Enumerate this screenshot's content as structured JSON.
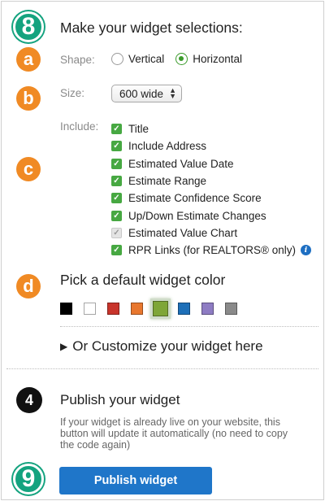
{
  "badges": {
    "step8": "8",
    "a": "a",
    "b": "b",
    "c": "c",
    "d": "d",
    "step4": "4",
    "step9": "9"
  },
  "selections": {
    "heading": "Make your widget selections:",
    "shape": {
      "label": "Shape:",
      "options": [
        {
          "label": "Vertical",
          "selected": false
        },
        {
          "label": "Horizontal",
          "selected": true
        }
      ]
    },
    "size": {
      "label": "Size:",
      "value": "600 wide"
    },
    "include": {
      "label": "Include:",
      "items": [
        {
          "label": "Title",
          "checked": true,
          "disabled": false
        },
        {
          "label": "Include Address",
          "checked": true,
          "disabled": false
        },
        {
          "label": "Estimated Value Date",
          "checked": true,
          "disabled": false
        },
        {
          "label": "Estimate Range",
          "checked": true,
          "disabled": false
        },
        {
          "label": "Estimate Confidence Score",
          "checked": true,
          "disabled": false
        },
        {
          "label": "Up/Down Estimate Changes",
          "checked": true,
          "disabled": false
        },
        {
          "label": "Estimated Value Chart",
          "checked": true,
          "disabled": true
        },
        {
          "label": "RPR Links (for REALTORS® only)",
          "checked": true,
          "disabled": false
        }
      ]
    }
  },
  "color": {
    "heading": "Pick a default widget color",
    "swatches": [
      {
        "name": "black",
        "hex": "#000000",
        "selected": false
      },
      {
        "name": "white",
        "hex": "#ffffff",
        "selected": false
      },
      {
        "name": "red",
        "hex": "#c8342b",
        "selected": false
      },
      {
        "name": "orange",
        "hex": "#e8772e",
        "selected": false
      },
      {
        "name": "green",
        "hex": "#7ea637",
        "selected": true
      },
      {
        "name": "blue",
        "hex": "#1d6fb8",
        "selected": false
      },
      {
        "name": "purple",
        "hex": "#8e7cc3",
        "selected": false
      },
      {
        "name": "gray",
        "hex": "#8a8a8a",
        "selected": false
      }
    ]
  },
  "customize": {
    "label": "Or Customize your widget here"
  },
  "publish": {
    "heading": "Publish your widget",
    "description": "If your widget is already live on your website, this button will update it automatically (no need to copy the code again)",
    "button_label": "Publish widget"
  },
  "colors": {
    "accent_orange": "#f08a24",
    "accent_green": "#14a37f",
    "button_blue": "#1f76c9",
    "check_green": "#47a842"
  }
}
